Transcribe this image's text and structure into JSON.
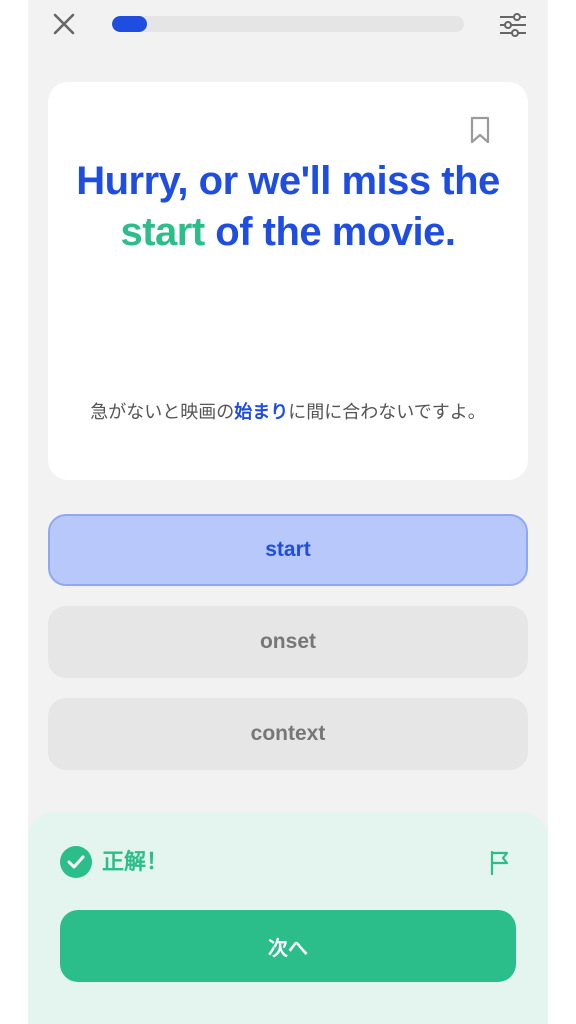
{
  "top_bar": {
    "close_icon": "close-icon",
    "settings_icon": "sliders-icon",
    "progress": 0.1
  },
  "card": {
    "sentence": {
      "before": "Hurry, or we'll miss the ",
      "highlight": "start",
      "after": " of the movie."
    },
    "translation": {
      "before": "急がないと映画の",
      "highlight": "始まり",
      "after": "に間に合わないですよ。"
    },
    "bookmark_icon": "bookmark-icon"
  },
  "options": [
    {
      "label": "start",
      "state": "selected"
    },
    {
      "label": "onset",
      "state": "default"
    },
    {
      "label": "context",
      "state": "default"
    }
  ],
  "feedback": {
    "status_icon": "check-circle-icon",
    "message": "正解！",
    "flag_icon": "flag-icon",
    "next_label": "次へ"
  },
  "colors": {
    "primary_blue": "#1f4de0",
    "accent_green": "#2bbd8a",
    "selected_bg": "#b8c8fb",
    "option_bg": "#e6e6e6",
    "feedback_bg": "#e3f5ee"
  }
}
